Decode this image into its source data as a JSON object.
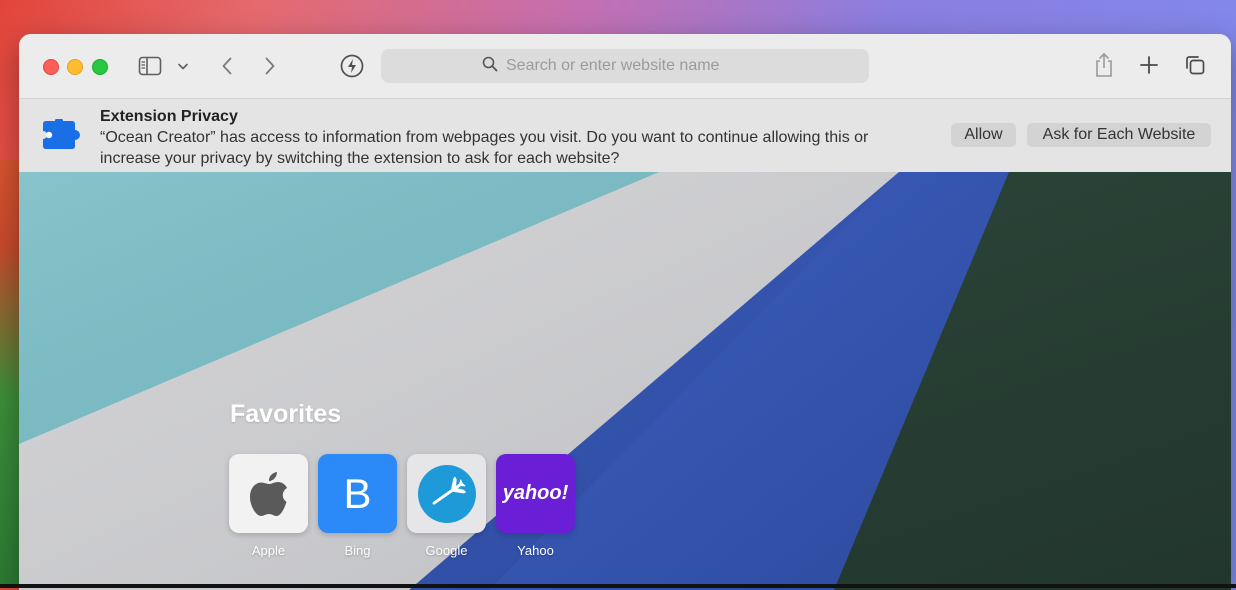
{
  "toolbar": {
    "search_placeholder": "Search or enter website name"
  },
  "banner": {
    "title": "Extension Privacy",
    "message": "“Ocean Creator” has access to information from webpages you visit. Do you want to continue allowing this or increase your privacy by switching the extension to ask for each website?",
    "allow_label": "Allow",
    "ask_label": "Ask for Each Website",
    "icon": "puzzle-piece-icon",
    "icon_color": "#1a6fe6"
  },
  "favorites": {
    "title": "Favorites",
    "items": [
      {
        "label": "Apple",
        "icon": "apple-logo-icon"
      },
      {
        "label": "Bing",
        "icon": "letter-b-icon",
        "tile_text": "B",
        "color": "#2b8af7"
      },
      {
        "label": "Google",
        "icon": "airplane-icon"
      },
      {
        "label": "Yahoo",
        "icon": "yahoo-wordmark-icon",
        "tile_text": "yahoo!",
        "color": "#6a1fd6"
      }
    ]
  }
}
